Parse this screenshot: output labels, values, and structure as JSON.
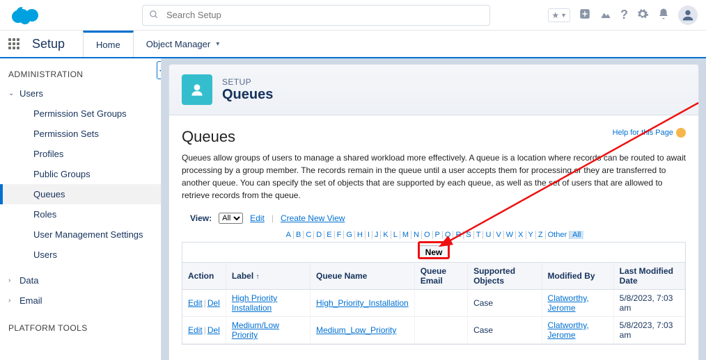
{
  "header": {
    "search_placeholder": "Search Setup",
    "star_icon": "★",
    "icons": [
      "plus",
      "swap",
      "help",
      "gear",
      "bell"
    ]
  },
  "nav": {
    "setup_label": "Setup",
    "tabs": [
      {
        "label": "Home",
        "active": true
      },
      {
        "label": "Object Manager",
        "active": false
      }
    ]
  },
  "sidebar": {
    "section_admin": "ADMINISTRATION",
    "users_label": "Users",
    "items": [
      "Permission Set Groups",
      "Permission Sets",
      "Profiles",
      "Public Groups",
      "Queues",
      "Roles",
      "User Management Settings",
      "Users"
    ],
    "data_label": "Data",
    "email_label": "Email",
    "section_platform": "PLATFORM TOOLS"
  },
  "main": {
    "breadcrumb": "SETUP",
    "title": "Queues",
    "content_heading": "Queues",
    "help_label": "Help for this Page",
    "description": "Queues allow groups of users to manage a shared workload more effectively. A queue is a location where records can be routed to await processing by a group member. The records remain in the queue until a user accepts them for processing or they are transferred to another queue. You can specify the set of objects that are supported by each queue, as well as the set of users that are allowed to retrieve records from the queue.",
    "view_label": "View:",
    "view_option": "All",
    "edit_link": "Edit",
    "create_view_link": "Create New View",
    "alpha": [
      "A",
      "B",
      "C",
      "D",
      "E",
      "F",
      "G",
      "H",
      "I",
      "J",
      "K",
      "L",
      "M",
      "N",
      "O",
      "P",
      "Q",
      "R",
      "S",
      "T",
      "U",
      "V",
      "W",
      "X",
      "Y",
      "Z"
    ],
    "alpha_other": "Other",
    "alpha_all": "All",
    "new_button": "New",
    "columns": {
      "action": "Action",
      "label": "Label",
      "queue_name": "Queue Name",
      "queue_email": "Queue Email",
      "supported_objects": "Supported Objects",
      "modified_by": "Modified By",
      "last_modified": "Last Modified Date"
    },
    "row_edit": "Edit",
    "row_del": "Del",
    "rows": [
      {
        "label": "High Priority Installation",
        "queue_name": "High_Priority_Installation",
        "queue_email": "",
        "supported": "Case",
        "modified_by": "Clatworthy, Jerome",
        "last_modified": "5/8/2023, 7:03 am"
      },
      {
        "label": "Medium/Low Priority",
        "queue_name": "Medium_Low_Priority",
        "queue_email": "",
        "supported": "Case",
        "modified_by": "Clatworthy, Jerome",
        "last_modified": "5/8/2023, 7:03 am"
      }
    ]
  }
}
